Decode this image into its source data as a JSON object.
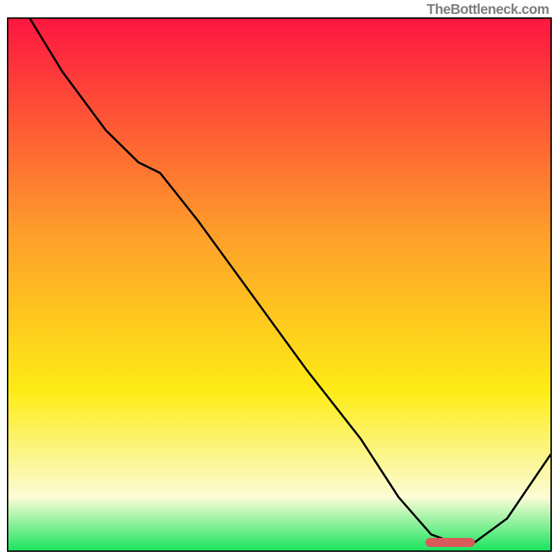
{
  "watermark": "TheBottleneck.com",
  "colors": {
    "gradient_top": "#fd1640",
    "gradient_mid1": "#fe9d2a",
    "gradient_mid2": "#fdec15",
    "gradient_mid3": "#fcfcd6",
    "gradient_bottom": "#1be45f",
    "curve": "#000000",
    "marker_fill": "#d95a5a",
    "marker_stroke": "#d95a5a",
    "border": "#000000"
  },
  "chart_data": {
    "type": "line",
    "title": "",
    "xlabel": "",
    "ylabel": "",
    "xlim": [
      0,
      100
    ],
    "ylim": [
      0,
      100
    ],
    "series": [
      {
        "name": "bottleneck-curve",
        "x": [
          4,
          10,
          18,
          24,
          28,
          35,
          45,
          55,
          65,
          72,
          78,
          82,
          86,
          92,
          100
        ],
        "y": [
          100,
          90,
          79,
          73,
          71,
          62,
          48,
          34,
          21,
          10,
          3,
          1.5,
          1.5,
          6,
          18
        ]
      }
    ],
    "marker": {
      "name": "highlight-range",
      "x_start": 77,
      "x_end": 86,
      "y": 1.5
    }
  }
}
